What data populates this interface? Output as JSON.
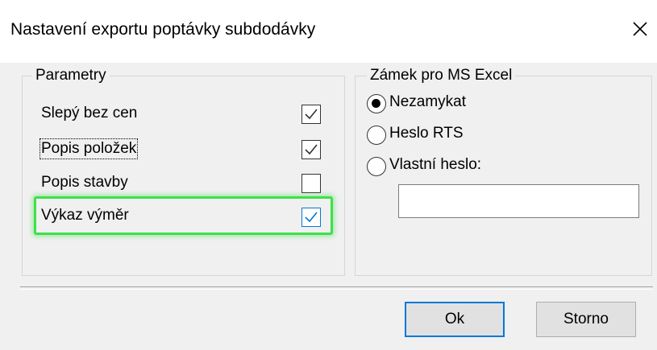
{
  "window": {
    "title": "Nastavení exportu poptávky subdodávky",
    "close_icon": "close-icon"
  },
  "parametry": {
    "legend": "Parametry",
    "items": [
      {
        "label": "Slepý bez cen",
        "checked": true
      },
      {
        "label": "Popis položek",
        "checked": true
      },
      {
        "label": "Popis stavby",
        "checked": false
      },
      {
        "label": "Výkaz výměr",
        "checked": true
      }
    ]
  },
  "excel_lock": {
    "legend": "Zámek pro MS Excel",
    "options": [
      {
        "label": "Nezamykat",
        "selected": true
      },
      {
        "label": "Heslo RTS",
        "selected": false
      },
      {
        "label": "Vlastní heslo:",
        "selected": false
      }
    ],
    "password_value": ""
  },
  "buttons": {
    "ok": "Ok",
    "cancel": "Storno"
  },
  "colors": {
    "highlight": "#3ee04a",
    "accent": "#0078d7"
  }
}
